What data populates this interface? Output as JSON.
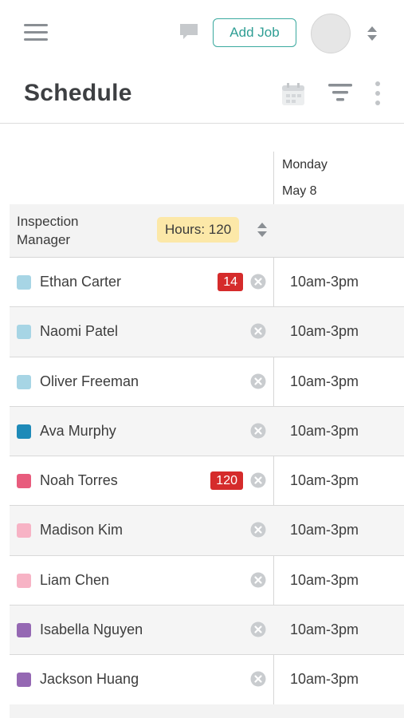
{
  "header": {
    "add_job_label": "Add Job"
  },
  "page": {
    "title": "Schedule"
  },
  "day": {
    "name": "Monday",
    "date": "May 8"
  },
  "group": {
    "title": "Inspection Manager",
    "hours": "Hours: 120"
  },
  "employees": [
    {
      "name": "Ethan Carter",
      "color": "#a7d5e5",
      "count": "14",
      "shift": "10am-3pm"
    },
    {
      "name": "Naomi Patel",
      "color": "#a7d5e5",
      "count": "",
      "shift": "10am-3pm"
    },
    {
      "name": "Oliver Freeman",
      "color": "#a7d5e5",
      "count": "",
      "shift": "10am-3pm"
    },
    {
      "name": "Ava Murphy",
      "color": "#1e8ab8",
      "count": "",
      "shift": "10am-3pm"
    },
    {
      "name": "Noah Torres",
      "color": "#e85c7d",
      "count": "120",
      "shift": "10am-3pm"
    },
    {
      "name": "Madison Kim",
      "color": "#f7b3c5",
      "count": "",
      "shift": "10am-3pm"
    },
    {
      "name": "Liam Chen",
      "color": "#f7b3c5",
      "count": "",
      "shift": "10am-3pm"
    },
    {
      "name": "Isabella Nguyen",
      "color": "#9568b3",
      "count": "",
      "shift": "10am-3pm"
    },
    {
      "name": "Jackson Huang",
      "color": "#9568b3",
      "count": "",
      "shift": "10am-3pm"
    }
  ],
  "colors": {
    "accent": "#3aa99f",
    "badge_red": "#d52b2b",
    "hours_badge": "#fce8a8"
  }
}
